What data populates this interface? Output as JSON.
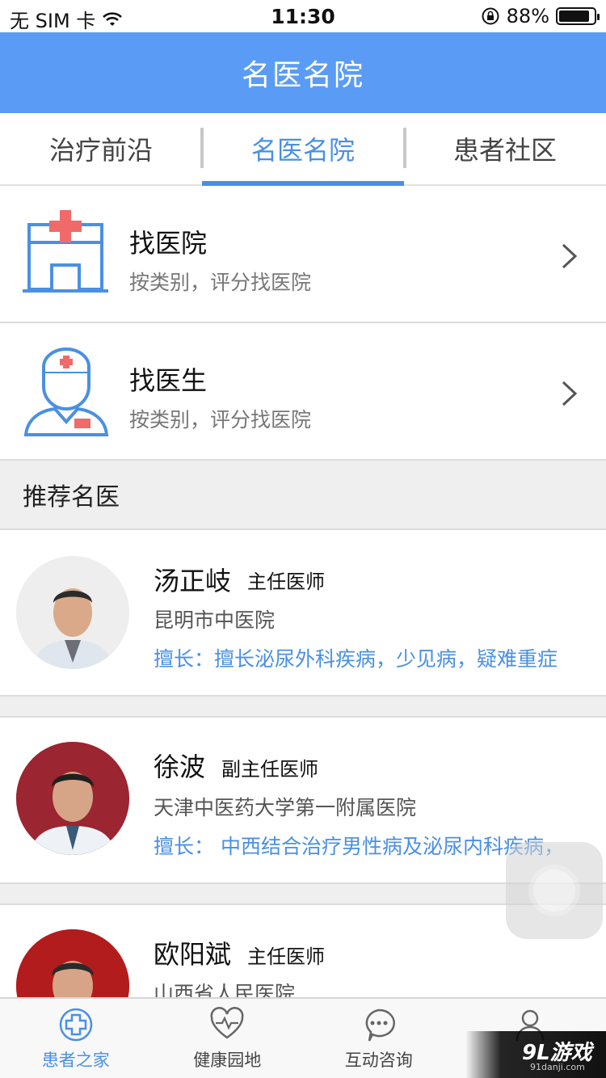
{
  "status_bar": {
    "carrier": "无 SIM 卡",
    "time": "11:30",
    "battery_level": "88%",
    "battery_fraction": 0.88
  },
  "nav": {
    "title": "名医名院"
  },
  "tabs": [
    {
      "label": "治疗前沿",
      "active": false
    },
    {
      "label": "名医名院",
      "active": true
    },
    {
      "label": "患者社区",
      "active": false
    }
  ],
  "menu": [
    {
      "icon": "hospital-icon",
      "title": "找医院",
      "subtitle": "按类别，评分找医院"
    },
    {
      "icon": "doctor-icon",
      "title": "找医生",
      "subtitle": "按类别，评分找医院"
    }
  ],
  "section": {
    "title": "推荐名医"
  },
  "doctors": [
    {
      "name": "汤正岐",
      "title": "主任医师",
      "hospital": "昆明市中医院",
      "specialty": "擅长：擅长泌尿外科疾病，少见病，疑难重症"
    },
    {
      "name": "徐波",
      "title": "副主任医师",
      "hospital": "天津中医药大学第一附属医院",
      "specialty": "擅长： 中西结合治疗男性病及泌尿内科疾病，"
    },
    {
      "name": "欧阳斌",
      "title": "主任医师",
      "hospital": "山西省人民医院",
      "specialty": ""
    }
  ],
  "tab_bar": [
    {
      "label": "患者之家",
      "icon": "plus-circle-icon",
      "active": true
    },
    {
      "label": "健康园地",
      "icon": "heart-pulse-icon",
      "active": false
    },
    {
      "label": "互动咨询",
      "icon": "chat-bubble-icon",
      "active": false
    },
    {
      "label": "",
      "icon": "person-icon",
      "active": false
    }
  ],
  "watermark": {
    "brand": "9L游戏",
    "site": "91danji.com"
  },
  "colors": {
    "primary": "#5a9cf5",
    "accent": "#4a90e2",
    "background": "#efefef"
  }
}
